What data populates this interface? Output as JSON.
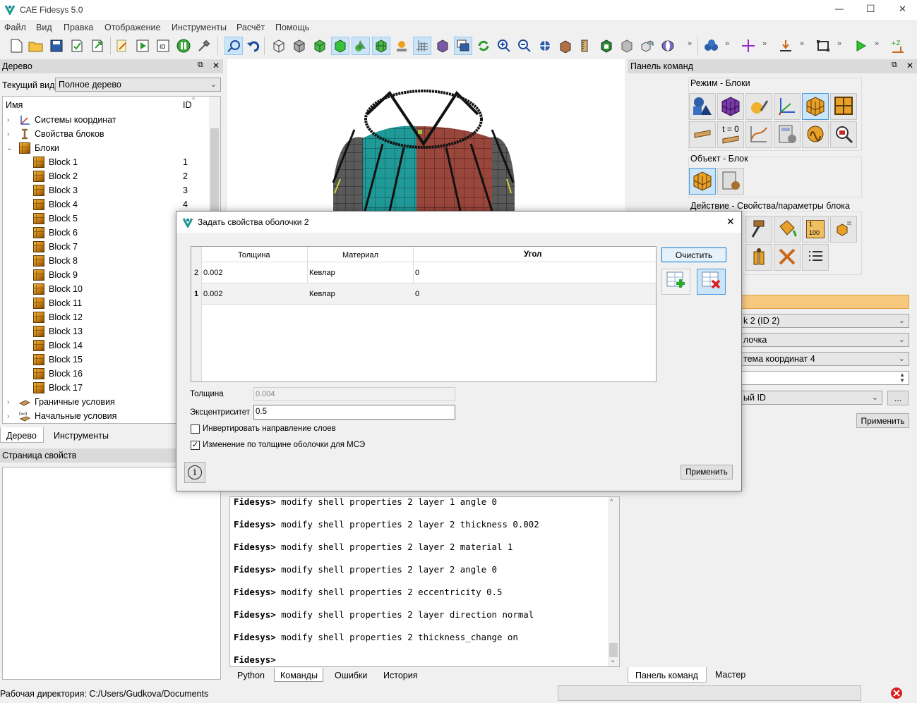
{
  "window": {
    "title": "CAE Fidesys 5.0",
    "minimize": "—",
    "maximize": "☐",
    "close": "✕"
  },
  "menu": [
    "Файл",
    "Вид",
    "Правка",
    "Отображение",
    "Инструменты",
    "Расчёт",
    "Помощь"
  ],
  "toolbar": {
    "overflow": "»"
  },
  "tree_panel": {
    "title": "Дерево",
    "float_icon": "⧉",
    "close_icon": "✕",
    "view_label": "Текущий вид",
    "view_value": "Полное дерево",
    "col_name": "Имя",
    "col_id": "ID",
    "coord_systems": "Системы координат",
    "block_props": "Свойства блоков",
    "blocks": "Блоки",
    "block_items": [
      {
        "name": "Block 1",
        "id": "1"
      },
      {
        "name": "Block 2",
        "id": "2"
      },
      {
        "name": "Block 3",
        "id": "3"
      },
      {
        "name": "Block 4",
        "id": "4"
      },
      {
        "name": "Block 5",
        "id": ""
      },
      {
        "name": "Block 6",
        "id": ""
      },
      {
        "name": "Block 7",
        "id": ""
      },
      {
        "name": "Block 8",
        "id": ""
      },
      {
        "name": "Block 9",
        "id": ""
      },
      {
        "name": "Block 10",
        "id": ""
      },
      {
        "name": "Block 11",
        "id": ""
      },
      {
        "name": "Block 12",
        "id": ""
      },
      {
        "name": "Block 13",
        "id": ""
      },
      {
        "name": "Block 14",
        "id": ""
      },
      {
        "name": "Block 15",
        "id": ""
      },
      {
        "name": "Block 16",
        "id": ""
      },
      {
        "name": "Block 17",
        "id": ""
      }
    ],
    "boundary": "Граничные условия",
    "initial": "Начальные условия",
    "tab_tree": "Дерево",
    "tab_tools": "Инструменты"
  },
  "props_panel": {
    "title": "Страница свойств"
  },
  "command_panel": {
    "title": "Панель команд",
    "mode_label": "Режим - Блоки",
    "object_label": "Объект - Блок",
    "action_label": "Действие - Свойства/параметры блока",
    "t0_label": "t = 0",
    "num_label": "100",
    "num_top": "1",
    "combo1": "k 2 (ID 2)",
    "combo2": "лочка",
    "combo3": "тема координат 4",
    "combo4": "ый ID",
    "dots": "...",
    "apply": "Применить",
    "tab_cmd": "Панель команд",
    "tab_master": "Мастер"
  },
  "dialog": {
    "title": "Задать свойства оболочки 2",
    "close": "✕",
    "columns": [
      "Толщина",
      "Материал",
      "Угол"
    ],
    "rows": [
      {
        "index": "2",
        "thickness": "0.002",
        "material": "Кевлар",
        "angle": "0"
      },
      {
        "index": "1",
        "thickness": "0.002",
        "material": "Кевлар",
        "angle": "0"
      }
    ],
    "clear_button": "Очистить",
    "thickness_label": "Толщина",
    "thickness_value": "0.004",
    "ecc_label": "Эксцентриситет",
    "ecc_value": "0.5",
    "invert_label": "Инвертировать направление слоев",
    "invert_checked": false,
    "change_label": "Изменение по толщине оболочки для МСЭ",
    "change_checked": true,
    "info_icon": "i",
    "apply": "Применить"
  },
  "console": {
    "prompt": "Fidesys>",
    "lines": [
      "modify shell properties 2 layer 1 angle 0",
      "modify shell properties 2 layer 2 thickness 0.002",
      "modify shell properties 2 layer 2 material 1",
      "modify shell properties 2 layer 2 angle 0",
      "modify shell properties 2 eccentricity 0.5",
      "modify shell properties 2 layer direction normal",
      "modify shell properties 2 thickness_change on",
      ""
    ],
    "tabs": [
      "Python",
      "Команды",
      "Ошибки",
      "История"
    ]
  },
  "status": {
    "workdir": "Рабочая директория: C:/Users/Gudkova/Documents"
  }
}
